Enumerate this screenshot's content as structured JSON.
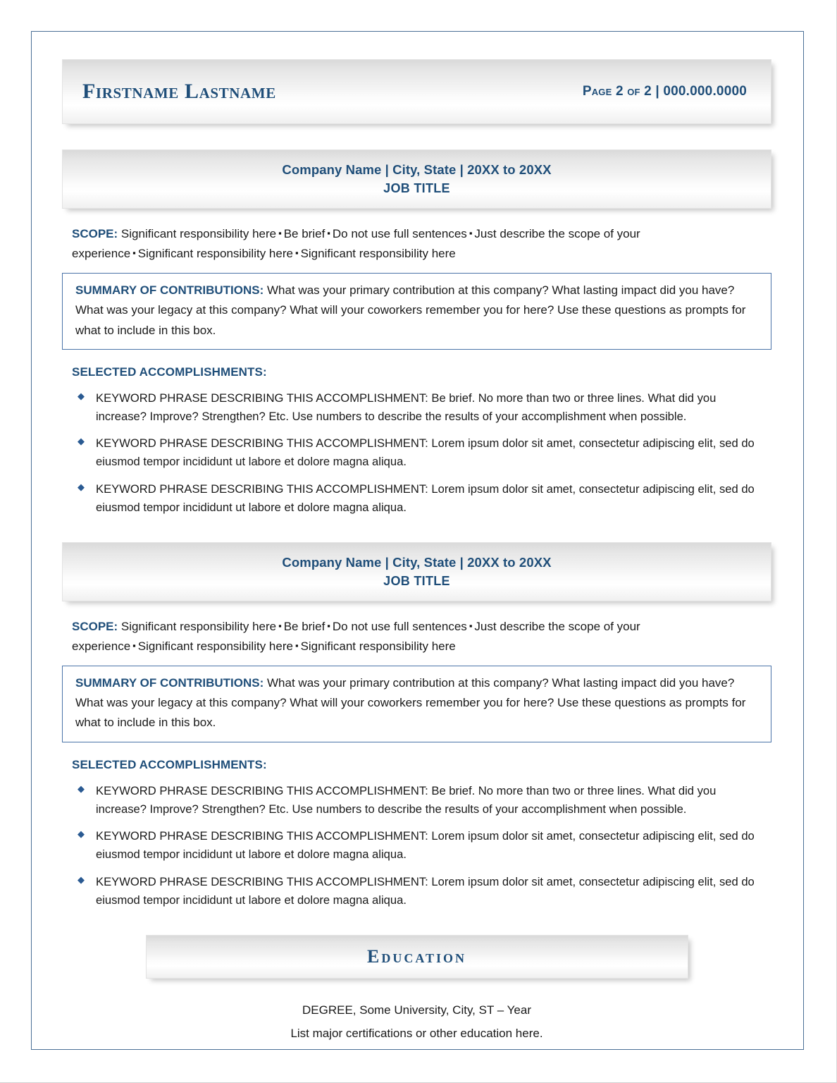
{
  "header": {
    "name": "Firstname Lastname",
    "page_info": "Page 2 of 2 | 000.000.0000"
  },
  "experience": [
    {
      "company_line": "Company Name  |  City, State  |  20XX to 20XX",
      "job_title": "JOB TITLE",
      "scope_label": "SCOPE:",
      "scope_items": [
        "Significant responsibility here",
        "Be brief",
        "Do not use full sentences",
        "Just describe the scope of your experience",
        "Significant responsibility here",
        "Significant responsibility here"
      ],
      "summary_label": "SUMMARY OF CONTRIBUTIONS:",
      "summary_text": "What was your primary contribution at this company? What lasting impact did you have? What was your legacy at this company? What will your coworkers remember you for here? Use these questions as prompts for what to include in this box.",
      "accomplishments_heading": "SELECTED ACCOMPLISHMENTS:",
      "accomplishments": [
        "KEYWORD PHRASE DESCRIBING THIS ACCOMPLISHMENT: Be brief. No more than two or three lines. What did you increase? Improve? Strengthen? Etc. Use numbers to describe the results of your accomplishment when possible.",
        "KEYWORD PHRASE DESCRIBING THIS ACCOMPLISHMENT: Lorem ipsum dolor sit amet, consectetur adipiscing elit, sed do eiusmod tempor incididunt ut labore et dolore magna aliqua.",
        "KEYWORD PHRASE DESCRIBING THIS ACCOMPLISHMENT: Lorem ipsum dolor sit amet, consectetur adipiscing elit, sed do eiusmod tempor incididunt ut labore et dolore magna aliqua."
      ]
    },
    {
      "company_line": "Company Name  |  City, State  |  20XX to 20XX",
      "job_title": "JOB TITLE",
      "scope_label": "SCOPE:",
      "scope_items": [
        "Significant responsibility here",
        "Be brief",
        "Do not use full sentences",
        "Just describe the scope of your experience",
        "Significant responsibility here",
        "Significant responsibility here"
      ],
      "summary_label": "SUMMARY OF CONTRIBUTIONS:",
      "summary_text": "What was your primary contribution at this company? What lasting impact did you have? What was your legacy at this company? What will your coworkers remember you for here? Use these questions as prompts for what to include in this box.",
      "accomplishments_heading": "SELECTED ACCOMPLISHMENTS:",
      "accomplishments": [
        "KEYWORD PHRASE DESCRIBING THIS ACCOMPLISHMENT: Be brief. No more than two or three lines. What did you increase? Improve? Strengthen? Etc. Use numbers to describe the results of your accomplishment when possible.",
        "KEYWORD PHRASE DESCRIBING THIS ACCOMPLISHMENT: Lorem ipsum dolor sit amet, consectetur adipiscing elit, sed do eiusmod tempor incididunt ut labore et dolore magna aliqua.",
        "KEYWORD PHRASE DESCRIBING THIS ACCOMPLISHMENT: Lorem ipsum dolor sit amet, consectetur adipiscing elit, sed do eiusmod tempor incididunt ut labore et dolore magna aliqua."
      ]
    }
  ],
  "education": {
    "title": "Education",
    "lines": [
      "DEGREE, Some University, City, ST – Year",
      "List major certifications or other education here."
    ]
  },
  "glyphs": {
    "scope_separator": "▪",
    "bullet_diamond": "◆"
  },
  "colors": {
    "accent_blue": "#1F4E79",
    "border_blue": "#4A6F96",
    "box_blue": "#4A73A8",
    "text": "#1A1A1A"
  }
}
